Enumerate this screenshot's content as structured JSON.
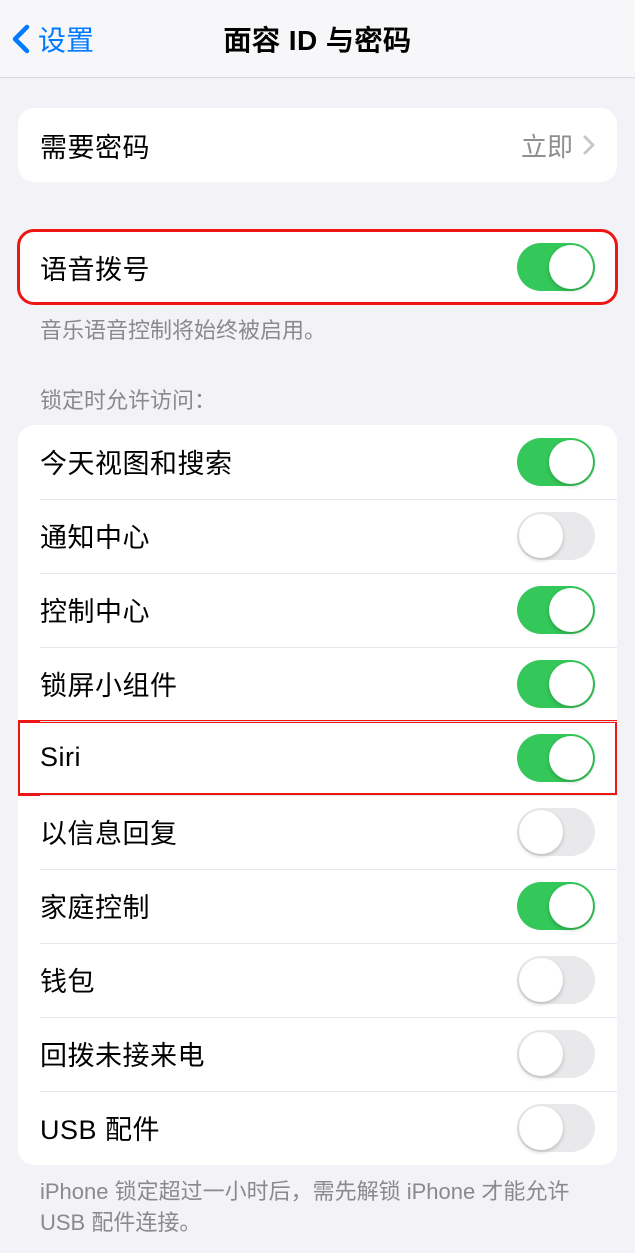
{
  "nav": {
    "back_label": "设置",
    "title": "面容 ID 与密码"
  },
  "require_passcode": {
    "label": "需要密码",
    "value": "立即"
  },
  "voice_dial": {
    "label": "语音拨号",
    "on": true,
    "footer": "音乐语音控制将始终被启用。"
  },
  "locked_access": {
    "header": "锁定时允许访问：",
    "items": [
      {
        "label": "今天视图和搜索",
        "on": true
      },
      {
        "label": "通知中心",
        "on": false
      },
      {
        "label": "控制中心",
        "on": true
      },
      {
        "label": "锁屏小组件",
        "on": true
      },
      {
        "label": "Siri",
        "on": true,
        "highlight": true
      },
      {
        "label": "以信息回复",
        "on": false
      },
      {
        "label": "家庭控制",
        "on": true
      },
      {
        "label": "钱包",
        "on": false
      },
      {
        "label": "回拨未接来电",
        "on": false
      },
      {
        "label": "USB 配件",
        "on": false
      }
    ],
    "footer": "iPhone 锁定超过一小时后，需先解锁 iPhone 才能允许USB 配件连接。"
  }
}
